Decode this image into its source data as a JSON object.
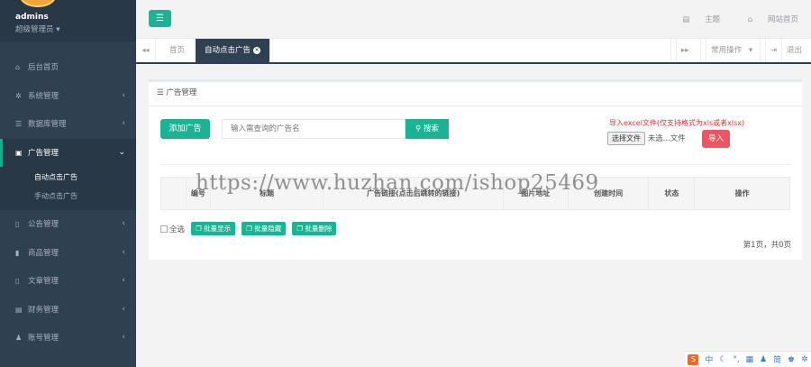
{
  "sidebar": {
    "username": "admins",
    "role": "超级管理员",
    "items": [
      {
        "label": "后台首页",
        "icon": "home-icon"
      },
      {
        "label": "系统管理",
        "icon": "gear-icon"
      },
      {
        "label": "数据库管理",
        "icon": "database-icon"
      },
      {
        "label": "广告管理",
        "icon": "image-icon"
      },
      {
        "label": "公告管理",
        "icon": "file-icon"
      },
      {
        "label": "商品管理",
        "icon": "file-icon"
      },
      {
        "label": "文章管理",
        "icon": "file-icon"
      },
      {
        "label": "财务管理",
        "icon": "money-icon"
      },
      {
        "label": "账号管理",
        "icon": "user-icon"
      }
    ],
    "submenu": [
      "自动点击广告",
      "手动点击广告"
    ]
  },
  "topbar": {
    "theme": "主题",
    "site_home": "网站首页"
  },
  "tabs": {
    "home": "首页",
    "active": "自动点击广告",
    "common_ops": "常用操作",
    "logout": "退出"
  },
  "panel": {
    "title": "广告管理",
    "add_button": "添加广告",
    "search_placeholder": "输入需查询的广告名",
    "search_button": "搜索",
    "import_hint": "导入excel文件(仅支持格式为xls或者xlsx)",
    "choose_file": "选择文件",
    "no_file": "未选...文件",
    "import_button": "导入",
    "columns": [
      "",
      "编号",
      "标题",
      "广告链接(点击后跳转的链接)",
      "图片地址",
      "创建时间",
      "状态",
      "操作"
    ],
    "select_all": "全选",
    "bulk_show": "批量显示",
    "bulk_hide": "批量隐藏",
    "bulk_delete": "批量删除",
    "pager": "第1页，共0页"
  },
  "watermark": "https://www.huzhan.com/ishop25469",
  "ime": [
    "中",
    "简"
  ]
}
